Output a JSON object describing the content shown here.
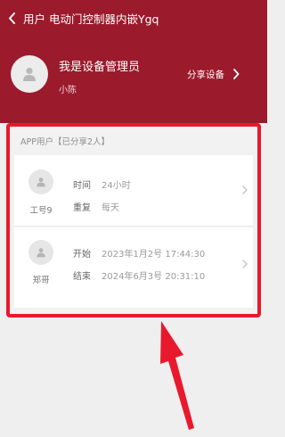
{
  "header": {
    "title": "用户 电动门控制器内嵌Ygq",
    "back_icon": "chevron-left-icon"
  },
  "manager": {
    "name": "我是设备管理员",
    "subtitle": "小陈",
    "share_label": "分享设备",
    "avatar_icon": "person-icon"
  },
  "app_users": {
    "header": "APP用户【已分享2人】",
    "users": [
      {
        "name": "工号9",
        "fields": [
          {
            "label": "时间",
            "value": "24小时"
          },
          {
            "label": "重复",
            "value": "每天"
          }
        ]
      },
      {
        "name": "郑哥",
        "fields": [
          {
            "label": "开始",
            "value": "2023年1月2号 17:44:30"
          },
          {
            "label": "结束",
            "value": "2024年6月3号 20:31:10"
          }
        ]
      }
    ]
  },
  "colors": {
    "header_bg": "#9b1a2c",
    "highlight": "#e8192c",
    "page_bg": "#efefef"
  }
}
